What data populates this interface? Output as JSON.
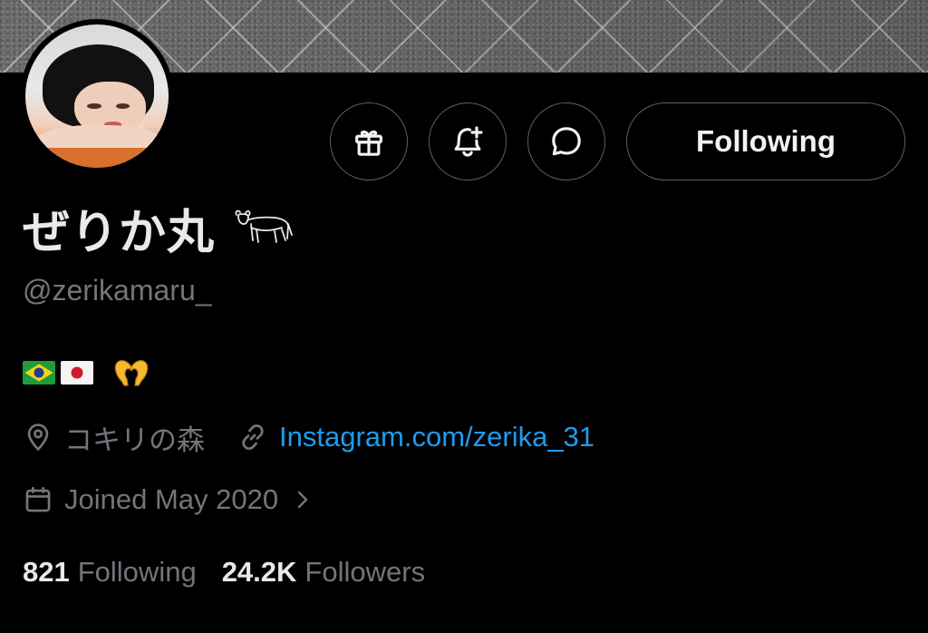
{
  "profile": {
    "display_name": "ぜりか丸",
    "name_emoji": "ox-emoji",
    "handle": "@zerikamaru_",
    "bio_emojis": [
      "brazil-flag",
      "japan-flag",
      "heart-hands"
    ],
    "location": "コキリの森",
    "link": "Instagram.com/zerika_31",
    "joined": "Joined May 2020",
    "following_count": "821",
    "following_label": "Following",
    "followers_count": "24.2K",
    "followers_label": "Followers"
  },
  "actions": {
    "follow_button_label": "Following",
    "icons": [
      "gift-icon",
      "bell-plus-icon",
      "message-icon"
    ]
  },
  "colors": {
    "background": "#000000",
    "text_primary": "#e7e9ea",
    "text_secondary": "#71767b",
    "link": "#1d9bf0",
    "border": "#536471"
  }
}
